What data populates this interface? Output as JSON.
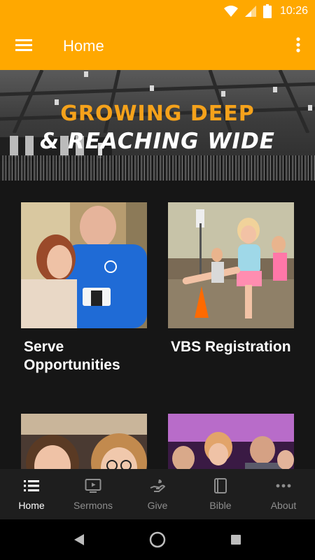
{
  "status": {
    "time": "10:26"
  },
  "app_bar": {
    "title": "Home"
  },
  "hero": {
    "line1": "GROWING DEEP",
    "line2": "& REACHING WIDE"
  },
  "cards": [
    {
      "title": "Serve Opportunities"
    },
    {
      "title": "VBS Registration"
    }
  ],
  "bottom_nav": {
    "items": [
      {
        "label": "Home",
        "icon": "list-icon",
        "active": true
      },
      {
        "label": "Sermons",
        "icon": "tv-play-icon"
      },
      {
        "label": "Give",
        "icon": "giving-hand-icon"
      },
      {
        "label": "Bible",
        "icon": "book-icon"
      },
      {
        "label": "About",
        "icon": "more-dots-icon"
      }
    ]
  },
  "colors": {
    "accent": "#ffa800",
    "background": "#161616",
    "nav_background": "#1e1e1e",
    "hero_text": "#f5a21b"
  }
}
